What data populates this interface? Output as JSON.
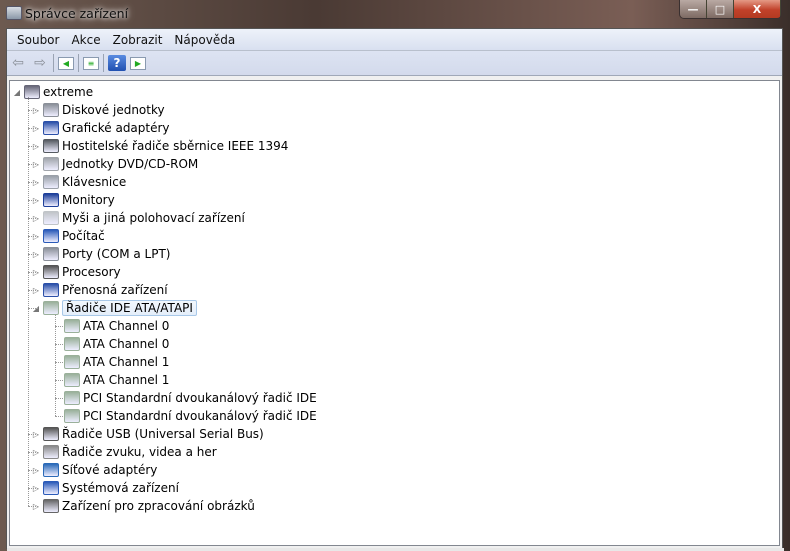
{
  "window": {
    "title": "Správce zařízení",
    "minimize": "—",
    "maximize": "□",
    "close": "X"
  },
  "menu": [
    "Soubor",
    "Akce",
    "Zobrazit",
    "Nápověda"
  ],
  "toolbar": {
    "back": "⇦",
    "forward": "⇨",
    "help": "?"
  },
  "tree": {
    "root": "extreme",
    "categories": [
      {
        "label": "Diskové jednotky",
        "color": "#8a8f98"
      },
      {
        "label": "Grafické adaptéry",
        "color": "#2a4fa8"
      },
      {
        "label": "Hostitelské řadiče sběrnice IEEE 1394",
        "color": "#555a60"
      },
      {
        "label": "Jednotky DVD/CD-ROM",
        "color": "#a0a4aa"
      },
      {
        "label": "Klávesnice",
        "color": "#9aa0a8"
      },
      {
        "label": "Monitory",
        "color": "#1d3f9a"
      },
      {
        "label": "Myši a jiná polohovací zařízení",
        "color": "#c0c4c8"
      },
      {
        "label": "Počítač",
        "color": "#2a5ab8"
      },
      {
        "label": "Porty (COM a LPT)",
        "color": "#8a8f98"
      },
      {
        "label": "Procesory",
        "color": "#555"
      },
      {
        "label": "Přenosná zařízení",
        "color": "#2a4fa8"
      },
      {
        "label": "Řadiče IDE ATA/ATAPI",
        "color": "#9ab09a",
        "expanded": true,
        "selected": true,
        "children": [
          "ATA Channel 0",
          "ATA Channel 0",
          "ATA Channel 1",
          "ATA Channel 1",
          "PCI Standardní dvoukanálový řadič IDE",
          "PCI Standardní dvoukanálový řadič IDE"
        ]
      },
      {
        "label": "Řadiče USB (Universal Serial Bus)",
        "color": "#555"
      },
      {
        "label": "Řadiče zvuku, videa a her",
        "color": "#888"
      },
      {
        "label": "Síťové adaptéry",
        "color": "#2a6ab8"
      },
      {
        "label": "Systémová zařízení",
        "color": "#2a5ab8"
      },
      {
        "label": "Zařízení pro zpracování obrázků",
        "color": "#666"
      }
    ]
  }
}
